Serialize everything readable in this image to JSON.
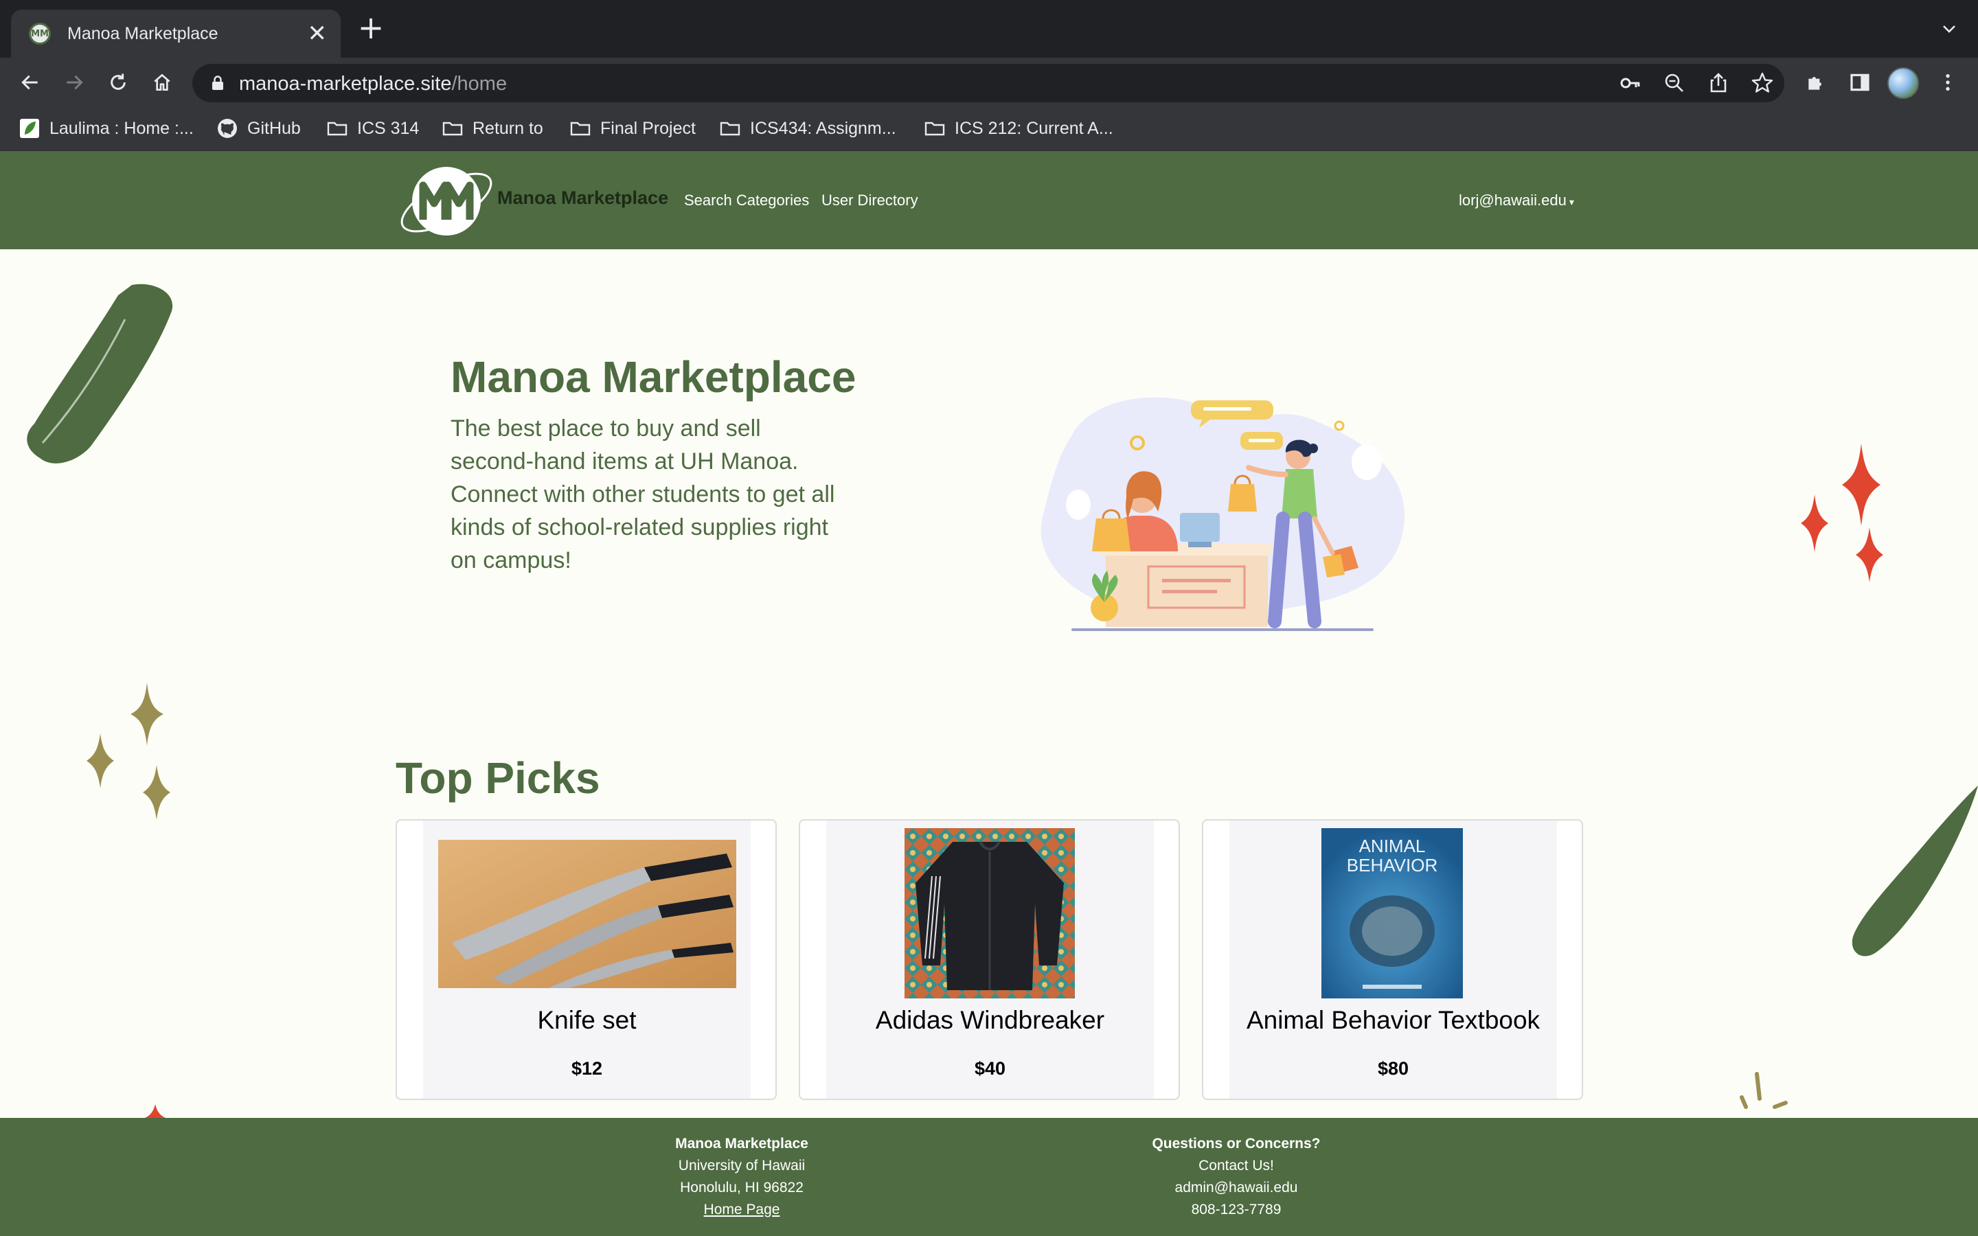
{
  "browser": {
    "tab_title": "Manoa Marketplace",
    "tab_close": "✕",
    "new_tab": "+",
    "url_host": "manoa-marketplace.site",
    "url_path": "/home",
    "bookmarks": [
      {
        "label": "Laulima : Home :...",
        "icon": "laulima-icon"
      },
      {
        "label": "GitHub",
        "icon": "github-icon"
      },
      {
        "label": "ICS 314",
        "icon": "folder-icon"
      },
      {
        "label": "Return to",
        "icon": "folder-icon"
      },
      {
        "label": "Final Project",
        "icon": "folder-icon"
      },
      {
        "label": "ICS434: Assignm...",
        "icon": "folder-icon"
      },
      {
        "label": "ICS 212: Current A...",
        "icon": "folder-icon"
      }
    ]
  },
  "navbar": {
    "brand": "Manoa Marketplace",
    "links": [
      "Search Categories",
      "User Directory"
    ],
    "user": "lorj@hawaii.edu",
    "logo_text": "MM"
  },
  "hero": {
    "title": "Manoa Marketplace",
    "text": "The best place to buy and sell second-hand items at UH Manoa. Connect with other students to get all kinds of school-related supplies right on campus!"
  },
  "top_picks": {
    "title": "Top Picks",
    "items": [
      {
        "name": "Knife set",
        "price": "$12"
      },
      {
        "name": "Adidas Windbreaker",
        "price": "$40"
      },
      {
        "name": "Animal Behavior Textbook",
        "price": "$80",
        "cover_text": "ANIMAL BEHAVIOR"
      }
    ]
  },
  "footer": {
    "left": {
      "heading": "Manoa Marketplace",
      "line1": "University of Hawaii",
      "line2": "Honolulu, HI 96822",
      "link": "Home Page"
    },
    "right": {
      "heading": "Questions or Concerns?",
      "line1": "Contact Us!",
      "line2": "admin@hawaii.edu",
      "line3": "808-123-7789"
    }
  },
  "colors": {
    "brand_green": "#4e6b41",
    "accent_red": "#e0452f",
    "accent_olive": "#9a8f52",
    "page_bg": "#fdfdf7"
  }
}
